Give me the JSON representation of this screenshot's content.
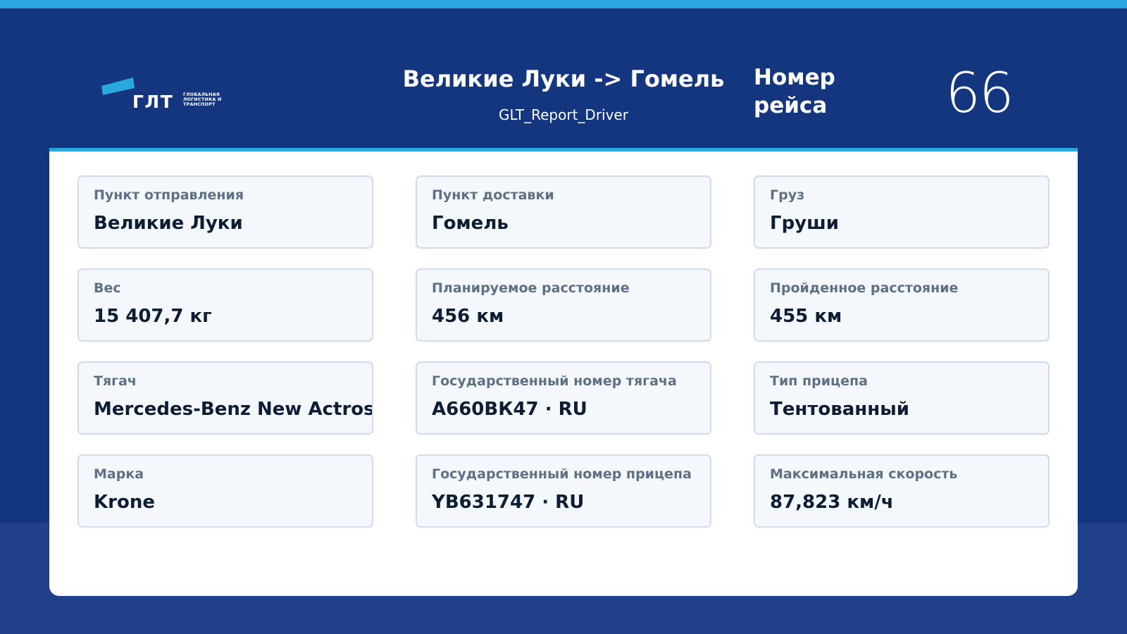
{
  "header": {
    "logo_text": "ГЛТ",
    "logo_caption_lines": [
      "ГЛОБАЛЬНАЯ",
      "ЛОГИСТИКА И",
      "ТРАНСПОРТ"
    ],
    "route_title": "Великие Луки -> Гомель",
    "report_name": "GLT_Report_Driver",
    "trip_label": "Номер рейса",
    "trip_number": "66"
  },
  "cards": [
    {
      "label": "Пункт отправления",
      "value": "Великие Луки"
    },
    {
      "label": "Пункт доставки",
      "value": "Гомель"
    },
    {
      "label": "Груз",
      "value": "Груши"
    },
    {
      "label": "Вес",
      "value": "15 407,7 кг"
    },
    {
      "label": "Планируемое расстояние",
      "value": "456 км"
    },
    {
      "label": "Пройденное расстояние",
      "value": "455 км"
    },
    {
      "label": "Тягач",
      "value": "Mercedes-Benz New Actros"
    },
    {
      "label": "Государственный номер тягача",
      "value": "А660ВК47 · RU"
    },
    {
      "label": "Тип прицепа",
      "value": "Тентованный"
    },
    {
      "label": "Марка",
      "value": "Krone"
    },
    {
      "label": "Государственный номер прицепа",
      "value": "YB631747 · RU"
    },
    {
      "label": "Максимальная скорость",
      "value": "87,823 км/ч"
    }
  ],
  "colors": {
    "primary_blue": "#13367f",
    "accent_blue": "#2ba7df",
    "footer_blue": "#20418a",
    "card_bg": "#f4f8fd",
    "card_border": "#cfdceb",
    "label_gray": "#5f6f84",
    "value_dark": "#0e1d33"
  }
}
